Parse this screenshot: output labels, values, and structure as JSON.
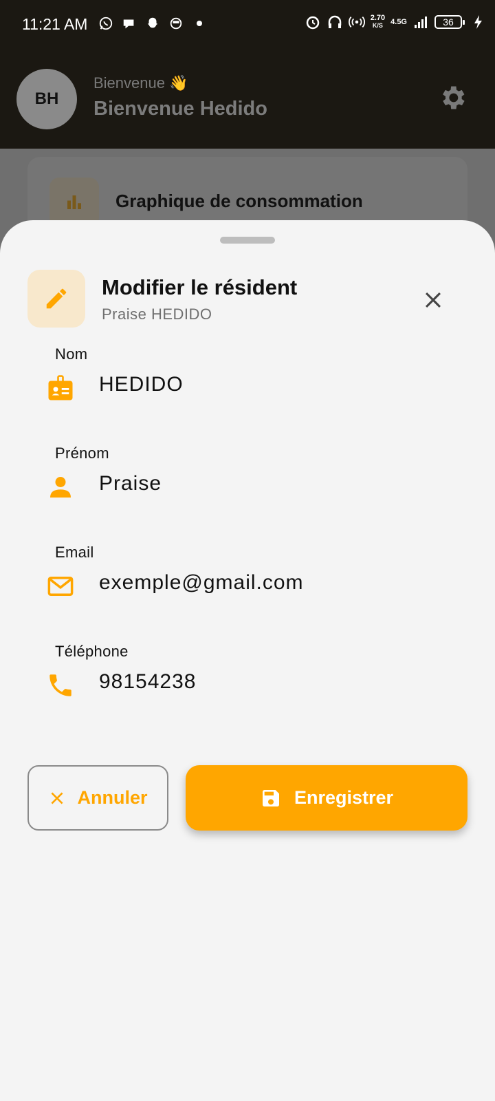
{
  "status_bar": {
    "time": "11:21 AM",
    "net_speed_value": "2.70",
    "net_speed_unit": "K/S",
    "network_type": "4.5G",
    "battery_level": "36"
  },
  "header": {
    "avatar_initials": "BH",
    "welcome_small": "Bienvenue 👋",
    "welcome_big": "Bienvenue Hedido"
  },
  "background_card": {
    "title": "Graphique de consommation"
  },
  "sheet": {
    "title": "Modifier le résident",
    "subtitle": "Praise HEDIDO"
  },
  "fields": {
    "nom": {
      "label": "Nom",
      "value": "HEDIDO"
    },
    "prenom": {
      "label": "Prénom",
      "value": "Praise"
    },
    "email": {
      "label": "Email",
      "value": "exemple@gmail.com"
    },
    "telephone": {
      "label": "Téléphone",
      "value": "98154238"
    }
  },
  "actions": {
    "cancel_label": "Annuler",
    "save_label": "Enregistrer"
  },
  "colors": {
    "accent": "#ffa600",
    "header_bg": "#1b1812",
    "sheet_bg": "#f4f4f4"
  },
  "icons": {
    "sb_left": [
      "whatsapp-icon",
      "message-icon",
      "snapchat-icon",
      "app-icon",
      "dot-icon"
    ],
    "sb_right": [
      "alarm-icon",
      "headphones-icon",
      "hotspot-icon",
      "signal-icon",
      "battery-icon",
      "charging-icon"
    ]
  }
}
